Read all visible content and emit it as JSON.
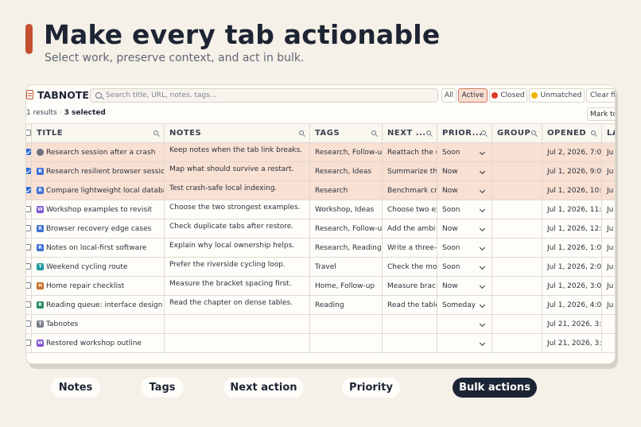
{
  "hero": {
    "title": "Make every tab actionable",
    "subtitle": "Select work, preserve context, and act in bulk."
  },
  "app": {
    "title": "TABNOTES",
    "logo_icon": "notes-icon",
    "search_placeholder": "Search title, URL, notes, tags...",
    "filters": [
      {
        "label": "All",
        "active": false
      },
      {
        "label": "Active",
        "active": true
      },
      {
        "label": "Closed",
        "active": false,
        "dot_color": "#e0392b"
      },
      {
        "label": "Unmatched",
        "active": false,
        "dot_color": "#f0b400"
      },
      {
        "label": "Clear fil"
      }
    ],
    "results_count": "1 results",
    "selected_count": "3 selected",
    "mark_button": "Mark to"
  },
  "table": {
    "columns": [
      "TITLE",
      "NOTES",
      "TAGS",
      "NEXT ...",
      "PRIOR...",
      "GROUP",
      "OPENED",
      "LA"
    ],
    "rows": [
      {
        "selected": true,
        "checked": true,
        "favicon": "",
        "favicon_color": "#6b7280",
        "favicon_icon": "globe-icon",
        "title": "Research session after a crash",
        "notes": "Keep notes when the tab link breaks.",
        "tags": "Research, Follow-up",
        "next": "Reattach the u",
        "priority": "Soon",
        "group": "",
        "opened": "Jul 2, 2026, 7:0...",
        "last": "Ju"
      },
      {
        "selected": true,
        "checked": true,
        "favicon": "R",
        "favicon_color": "#3a6fd8",
        "title": "Research resilient browser sessions",
        "notes": "Map what should survive a restart.",
        "tags": "Research, Ideas",
        "next": "Summarize th",
        "priority": "Now",
        "group": "",
        "opened": "Jul 1, 2026, 9:0...",
        "last": "Ju"
      },
      {
        "selected": true,
        "checked": true,
        "favicon": "R",
        "favicon_color": "#3a6fd8",
        "title": "Compare lightweight local databa...",
        "notes": "Test crash-safe local indexing.",
        "tags": "Research",
        "next": "Benchmark cr",
        "priority": "Now",
        "group": "",
        "opened": "Jul 1, 2026, 10:...",
        "last": "Ju"
      },
      {
        "selected": false,
        "checked": false,
        "favicon": "W",
        "favicon_color": "#7a4fd6",
        "title": "Workshop examples to revisit",
        "notes": "Choose the two strongest examples.",
        "tags": "Workshop, Ideas",
        "next": "Choose two ex",
        "priority": "Soon",
        "group": "",
        "opened": "Jul 1, 2026, 11:...",
        "last": "Ju"
      },
      {
        "selected": false,
        "checked": false,
        "favicon": "R",
        "favicon_color": "#3a6fd8",
        "title": "Browser recovery edge cases",
        "notes": "Check duplicate tabs after restore.",
        "tags": "Research, Follow-up",
        "next": "Add the ambi",
        "priority": "Now",
        "group": "",
        "opened": "Jul 1, 2026, 12:...",
        "last": "Ju"
      },
      {
        "selected": false,
        "checked": false,
        "favicon": "R",
        "favicon_color": "#3a6fd8",
        "title": "Notes on local-first software",
        "notes": "Explain why local ownership helps.",
        "tags": "Research, Reading",
        "next": "Write a three-",
        "priority": "Soon",
        "group": "",
        "opened": "Jul 1, 2026, 1:0...",
        "last": "Ju"
      },
      {
        "selected": false,
        "checked": false,
        "favicon": "T",
        "favicon_color": "#1e9aa0",
        "title": "Weekend cycling route",
        "notes": "Prefer the riverside cycling loop.",
        "tags": "Travel",
        "next": "Check the mo",
        "priority": "Soon",
        "group": "",
        "opened": "Jul 1, 2026, 2:0...",
        "last": "Ju"
      },
      {
        "selected": false,
        "checked": false,
        "favicon": "H",
        "favicon_color": "#c86a1e",
        "title": "Home repair checklist",
        "notes": "Measure the bracket spacing first.",
        "tags": "Home, Follow-up",
        "next": "Measure brac",
        "priority": "Now",
        "group": "",
        "opened": "Jul 1, 2026, 3:0...",
        "last": "Ju"
      },
      {
        "selected": false,
        "checked": false,
        "favicon": "R",
        "favicon_color": "#1f8a5a",
        "title": "Reading queue: interface design",
        "notes": "Read the chapter on dense tables.",
        "tags": "Reading",
        "next": "Read the table",
        "priority": "Someday",
        "group": "",
        "opened": "Jul 1, 2026, 4:0...",
        "last": "Ju"
      },
      {
        "selected": false,
        "checked": false,
        "favicon": "T",
        "favicon_color": "#7a7f89",
        "title": "Tabnotes",
        "notes": "",
        "tags": "",
        "next": "",
        "priority": "",
        "group": "",
        "opened": "Jul 21, 2026, 3:...",
        "last": ""
      },
      {
        "selected": false,
        "checked": false,
        "favicon": "W",
        "favicon_color": "#7a4fd6",
        "title": "Restored workshop outline",
        "notes": "",
        "tags": "",
        "next": "",
        "priority": "",
        "group": "",
        "opened": "Jul 21, 2026, 3:...",
        "last": ""
      }
    ]
  },
  "pills": [
    {
      "label": "Notes",
      "dark": false
    },
    {
      "label": "Tags",
      "dark": false
    },
    {
      "label": "Next action",
      "dark": false
    },
    {
      "label": "Priority",
      "dark": false
    },
    {
      "label": "Bulk actions",
      "dark": true
    }
  ]
}
